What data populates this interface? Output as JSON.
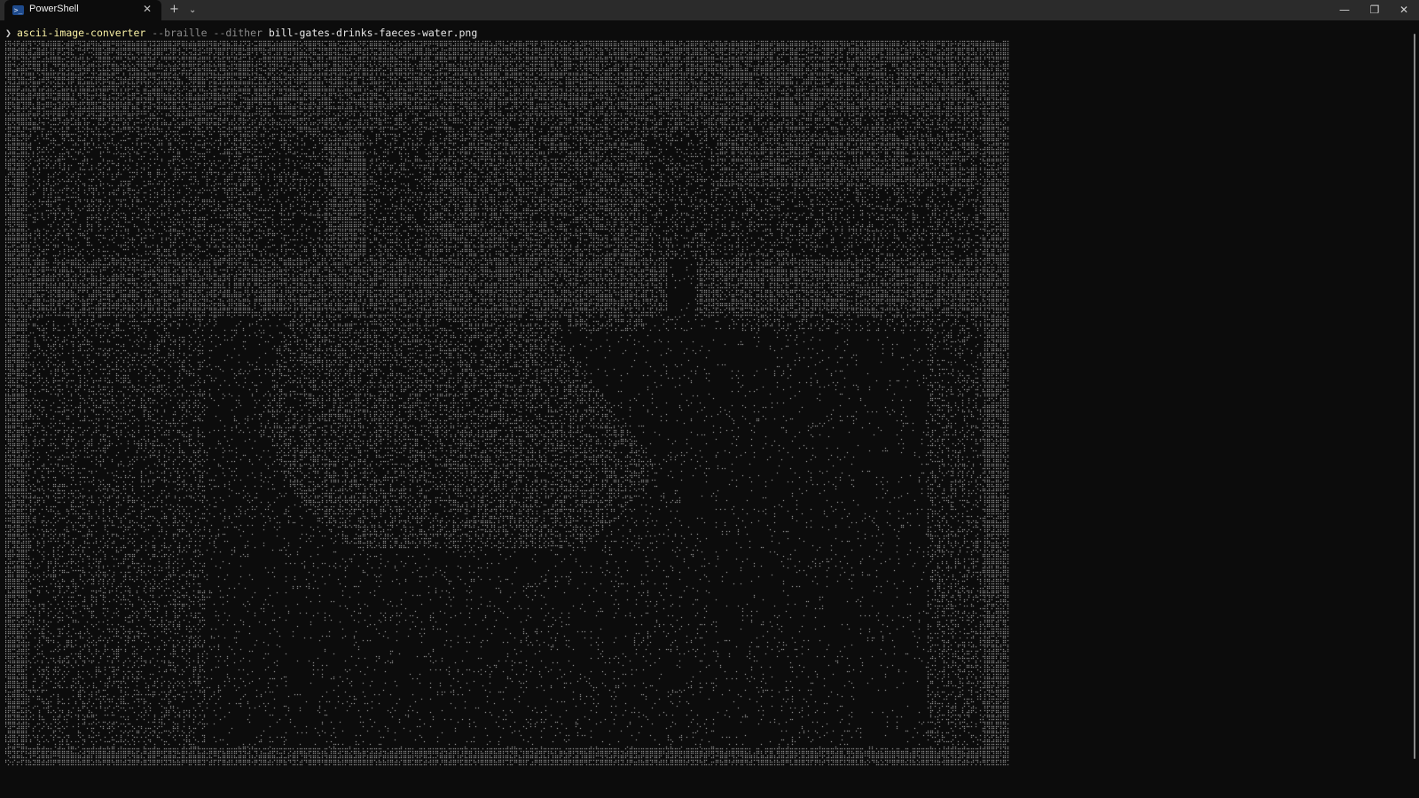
{
  "window": {
    "tab_title": "PowerShell",
    "tab_close_glyph": "✕",
    "new_tab_glyph": "+",
    "tab_dropdown_glyph": "⌄",
    "minimize_glyph": "—",
    "maximize_glyph": "❐",
    "close_glyph": "✕",
    "tab_icon": "powershell-icon",
    "tab_icon_glyph": ">_"
  },
  "terminal": {
    "prompt_glyph": "❯",
    "command": {
      "name": "ascii-image-converter",
      "param1": "--braille",
      "param2": "--dither",
      "argument": "bill-gates-drinks-faeces-water.png"
    },
    "colors": {
      "background": "#0c0c0c",
      "foreground": "#cccccc",
      "command": "#f9f1a5",
      "parameter": "#8a8a8a"
    },
    "output": {
      "type": "braille-dithered-ascii-art",
      "glyph_color": "#d9d9d9"
    }
  }
}
